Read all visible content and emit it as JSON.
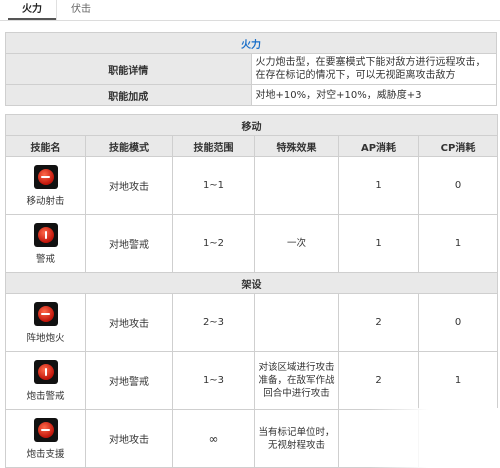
{
  "tabs": [
    {
      "label": "火力",
      "active": true
    },
    {
      "label": "伏击",
      "active": false
    }
  ],
  "fire": {
    "title": "火力",
    "rows": [
      {
        "label": "职能详情",
        "value": "火力炮击型，在要塞模式下能对敌方进行远程攻击，在存在标记的情况下，可以无视距离攻击敌方"
      },
      {
        "label": "职能加成",
        "value": "对地+10%，对空+10%，威胁度+3"
      }
    ]
  },
  "move": {
    "title": "移动",
    "headers": [
      "技能名",
      "技能模式",
      "技能范围",
      "特殊效果",
      "AP消耗",
      "CP消耗"
    ],
    "skills": [
      {
        "name": "移动射击",
        "mode": "对地攻击",
        "range": "1~1",
        "effect": "",
        "ap": "1",
        "cp": "0"
      },
      {
        "name": "警戒",
        "mode": "对地警戒",
        "range": "1~2",
        "effect": "一次",
        "ap": "1",
        "cp": "1"
      }
    ],
    "subtitle": "架设",
    "deploy_skills": [
      {
        "name": "阵地炮火",
        "mode": "对地攻击",
        "range": "2~3",
        "effect": "",
        "ap": "2",
        "cp": "0"
      },
      {
        "name": "炮击警戒",
        "mode": "对地警戒",
        "range": "1~3",
        "effect": "对该区域进行攻击准备，在敌军作战回合中进行攻击",
        "ap": "2",
        "cp": "1"
      },
      {
        "name": "炮击支援",
        "mode": "对地攻击",
        "range": "∞",
        "effect": "当有标记单位时，无视射程攻击",
        "ap": "",
        "cp": ""
      }
    ]
  },
  "icons": {
    "attack": "cannon-icon",
    "guard": "alert-icon"
  },
  "colors": {
    "accent": "#1a6fc9",
    "header_bg": "#e9e9e9",
    "icon_red": "#c0140a"
  }
}
